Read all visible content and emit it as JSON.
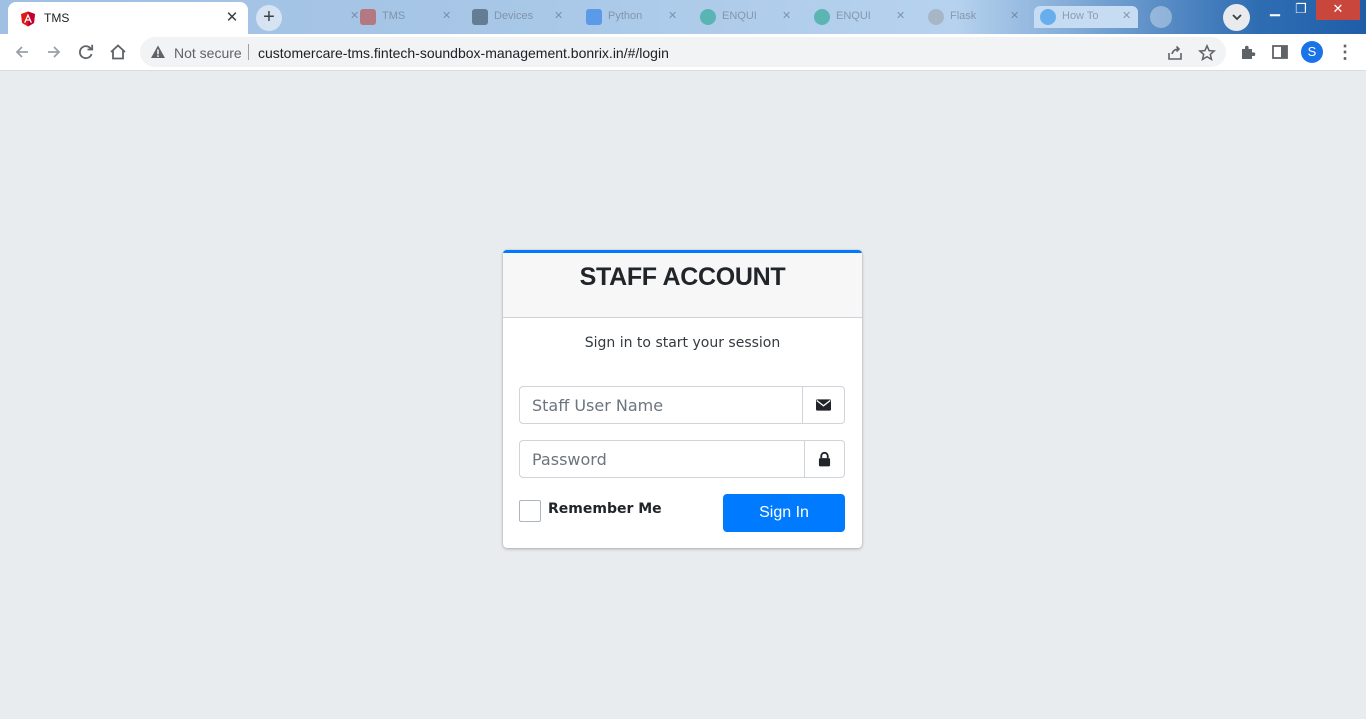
{
  "browser": {
    "active_tab": {
      "title": "TMS",
      "favicon": "angular-icon"
    },
    "background_tabs": [
      {
        "title": "",
        "favicon_color": "#c0392b"
      },
      {
        "title": "TMS",
        "favicon_color": "#c0392b"
      },
      {
        "title": "Devices",
        "favicon_color": "#2c3e50"
      },
      {
        "title": "Python",
        "favicon_color": "#1a73e8"
      },
      {
        "title": "ENQUI",
        "favicon_color": "#16a085"
      },
      {
        "title": "ENQUI",
        "favicon_color": "#16a085"
      },
      {
        "title": "Flask",
        "favicon_color": "#9aa0a6"
      },
      {
        "title": "How To",
        "favicon_color": "#1e88e5"
      }
    ],
    "new_tab_label": "+",
    "security_label": "Not secure",
    "url": "customercare-tms.fintech-soundbox-management.bonrix.in/#/login",
    "profile_initial": "S"
  },
  "login": {
    "header_title": "STAFF ACCOUNT",
    "message": "Sign in to start your session",
    "username_placeholder": "Staff User Name",
    "password_placeholder": "Password",
    "remember_label": "Remember Me",
    "signin_label": "Sign In"
  },
  "colors": {
    "page_background": "#e9ecef",
    "accent": "#007bff"
  }
}
